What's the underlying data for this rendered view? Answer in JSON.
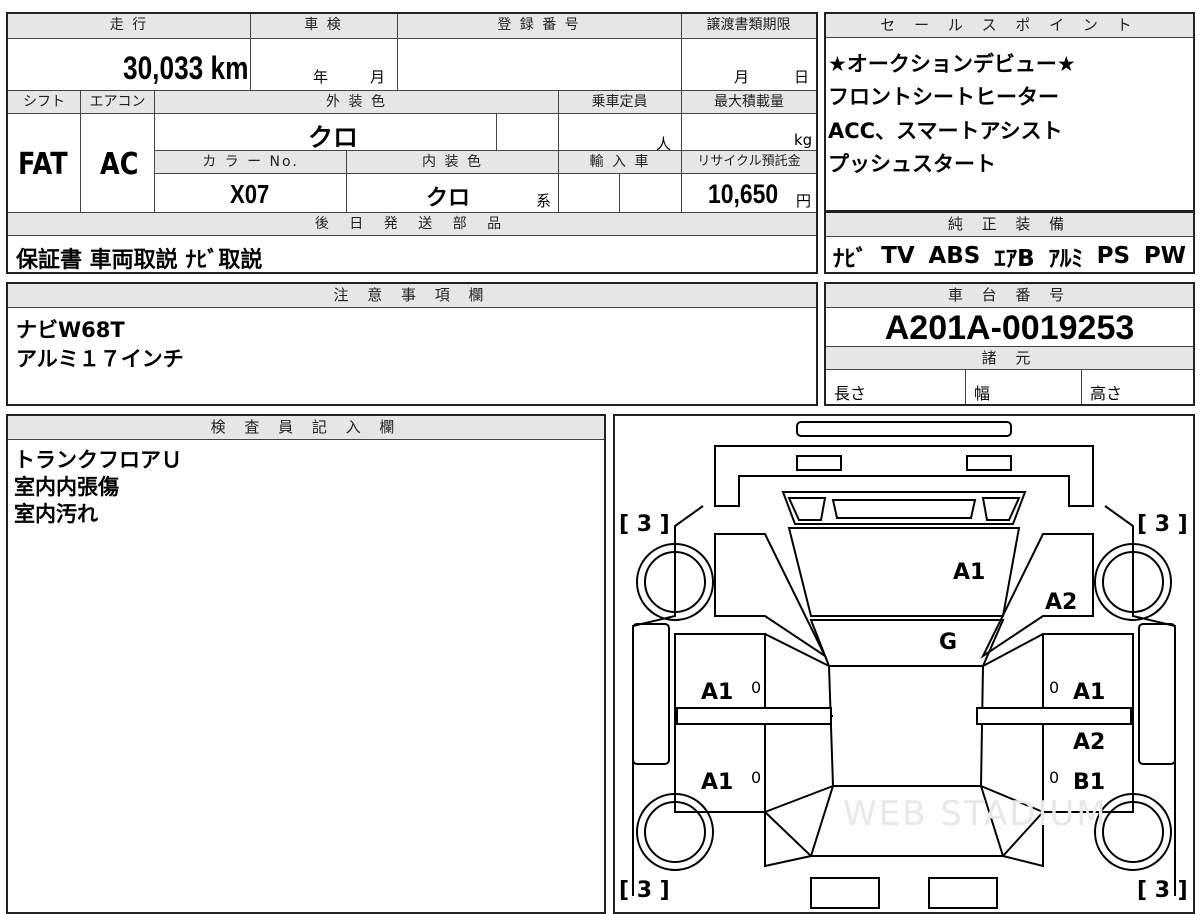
{
  "top": {
    "mileage_header": "走 行",
    "mileage_value": "30,033 km",
    "inspection_header": "車 検",
    "inspection_year_label": "年",
    "inspection_month_label": "月",
    "registration_header": "登 録 番 号",
    "transfer_header": "譲渡書類期限",
    "transfer_month_label": "月",
    "transfer_day_label": "日",
    "shift_header": "シフト",
    "shift_value": "FAT",
    "ac_header": "エアコン",
    "ac_value": "AC",
    "exterior_header": "外 装 色",
    "exterior_value": "クロ",
    "capacity_header": "乗車定員",
    "capacity_unit": "人",
    "maxload_header": "最大積載量",
    "maxload_unit": "kg",
    "colorno_header": "カ ラ ー No.",
    "colorno_value": "X07",
    "interior_header": "内 装 色",
    "interior_value": "クロ",
    "interior_suffix": "系",
    "import_header": "輸 入 車",
    "recycle_header": "リサイクル預託金",
    "recycle_value": "10,650",
    "recycle_unit": "円",
    "later_header": "後 日 発 送 部 品",
    "later_value": "保証書 車両取説 ﾅﾋﾞ取説"
  },
  "sales": {
    "header": "セ ー ル ス ポ イ ン ト",
    "lines": [
      "★オークションデビュー★",
      "フロントシートヒーター",
      "ACC、スマートアシスト",
      "プッシュスタート"
    ]
  },
  "equipment": {
    "header": "純 正 装 備",
    "items": [
      "ﾅﾋﾞ",
      "TV",
      "ABS",
      "ｴｱB",
      "ｱﾙﾐ",
      "PS",
      "PW"
    ]
  },
  "notes": {
    "header": "注 意 事 項 欄",
    "lines": [
      "ナビW68T",
      "アルミ１７インチ"
    ]
  },
  "chassis": {
    "header": "車 台 番 号",
    "value": "A201A-0019253",
    "spec_header": "諸 元",
    "length_label": "長さ",
    "width_label": "幅",
    "height_label": "高さ"
  },
  "inspector": {
    "header": "検 査 員 記 入 欄",
    "lines": [
      "トランクフロアＵ",
      "室内内張傷",
      "室内汚れ"
    ]
  },
  "diagram": {
    "tire_tl": "[ 3 ]",
    "tire_tr": "[ 3 ]",
    "tire_bl": "[ 3 ]",
    "tire_br": "[ 3 ]",
    "mark_a1_top": "A1",
    "mark_a2_right_top": "A2",
    "mark_g": "G",
    "mark_a1_left_mid": "A1",
    "mark_a1_right_mid": "A1",
    "mark_a2_right_low": "A2",
    "mark_a1_left_low": "A1",
    "mark_b1_right_low": "B1",
    "zero_1": "0",
    "zero_2": "0",
    "zero_3": "0",
    "zero_4": "0",
    "watermark": "WEB STADIUM"
  }
}
